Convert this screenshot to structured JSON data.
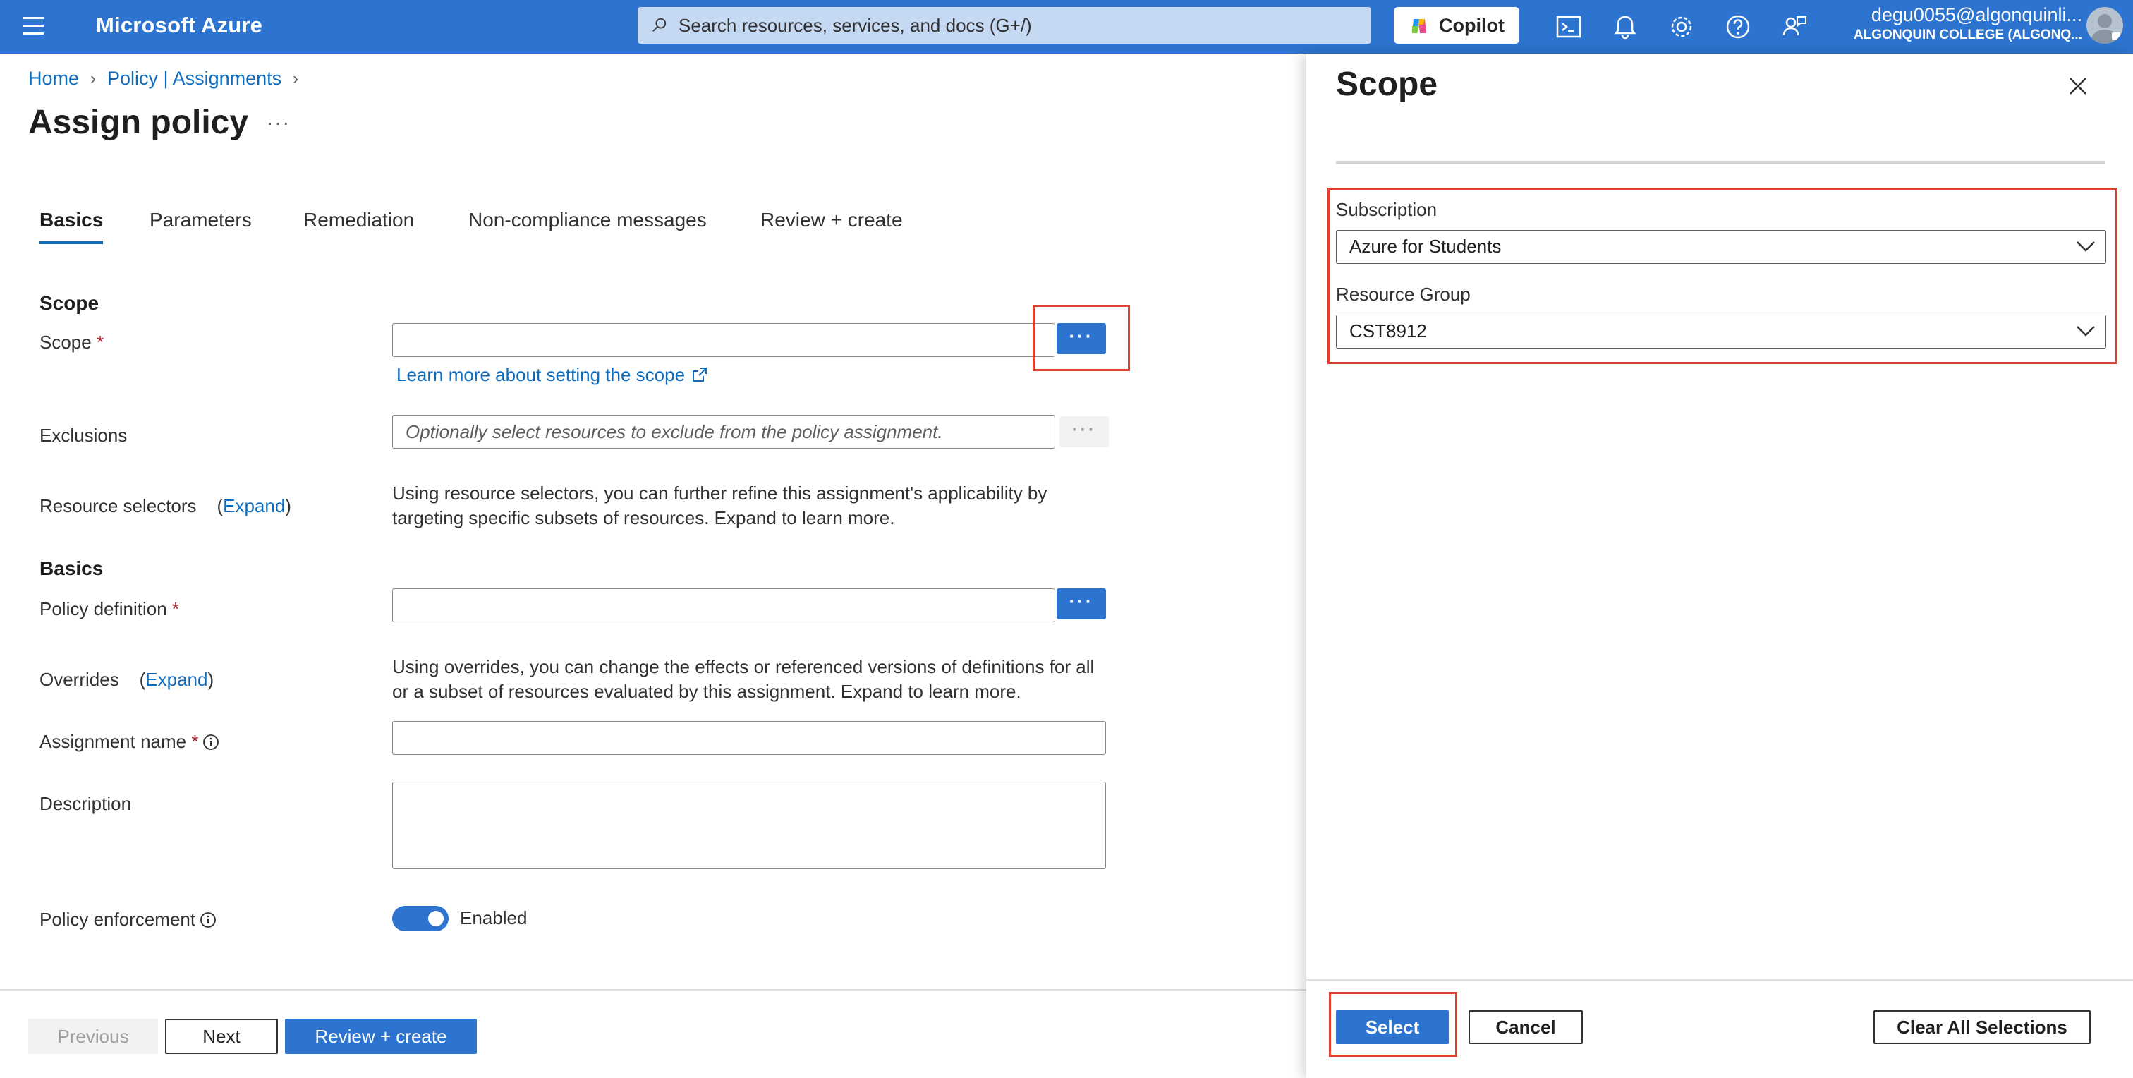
{
  "topbar": {
    "brand": "Microsoft Azure",
    "search_placeholder": "Search resources, services, and docs (G+/)",
    "copilot_label": "Copilot",
    "account_email": "degu0055@algonquinli...",
    "account_org": "ALGONQUIN COLLEGE (ALGONQ..."
  },
  "breadcrumb": {
    "items": [
      "Home",
      "Policy | Assignments"
    ]
  },
  "page": {
    "title": "Assign policy",
    "more": "···"
  },
  "tabs": [
    "Basics",
    "Parameters",
    "Remediation",
    "Non-compliance messages",
    "Review + create"
  ],
  "form": {
    "scope_section": "Scope",
    "scope_label": "Scope",
    "scope_value": "",
    "learn_more": "Learn more about setting the scope",
    "exclusions_label": "Exclusions",
    "exclusions_placeholder": "Optionally select resources to exclude from the policy assignment.",
    "resource_selectors_label": "Resource selectors",
    "expand": "Expand",
    "resource_selectors_desc": "Using resource selectors, you can further refine this assignment's applicability by targeting specific subsets of resources. Expand to learn more.",
    "basics_section": "Basics",
    "policy_definition_label": "Policy definition",
    "overrides_label": "Overrides",
    "overrides_desc": "Using overrides, you can change the effects or referenced versions of definitions for all or a subset of resources evaluated by this assignment. Expand to learn more.",
    "assignment_name_label": "Assignment name",
    "description_label": "Description",
    "policy_enforcement_label": "Policy enforcement",
    "enforcement_value": "Enabled",
    "required_mark": "*",
    "ellipsis": "···"
  },
  "footer": {
    "previous": "Previous",
    "next": "Next",
    "review_create": "Review + create"
  },
  "panel": {
    "title": "Scope",
    "subscription_label": "Subscription",
    "subscription_value": "Azure for Students",
    "resource_group_label": "Resource Group",
    "resource_group_value": "CST8912",
    "select": "Select",
    "cancel": "Cancel",
    "clear_all": "Clear All Selections"
  },
  "colors": {
    "accent": "#2c74cf",
    "highlight": "#e0402f",
    "link": "#0f6cbd"
  }
}
